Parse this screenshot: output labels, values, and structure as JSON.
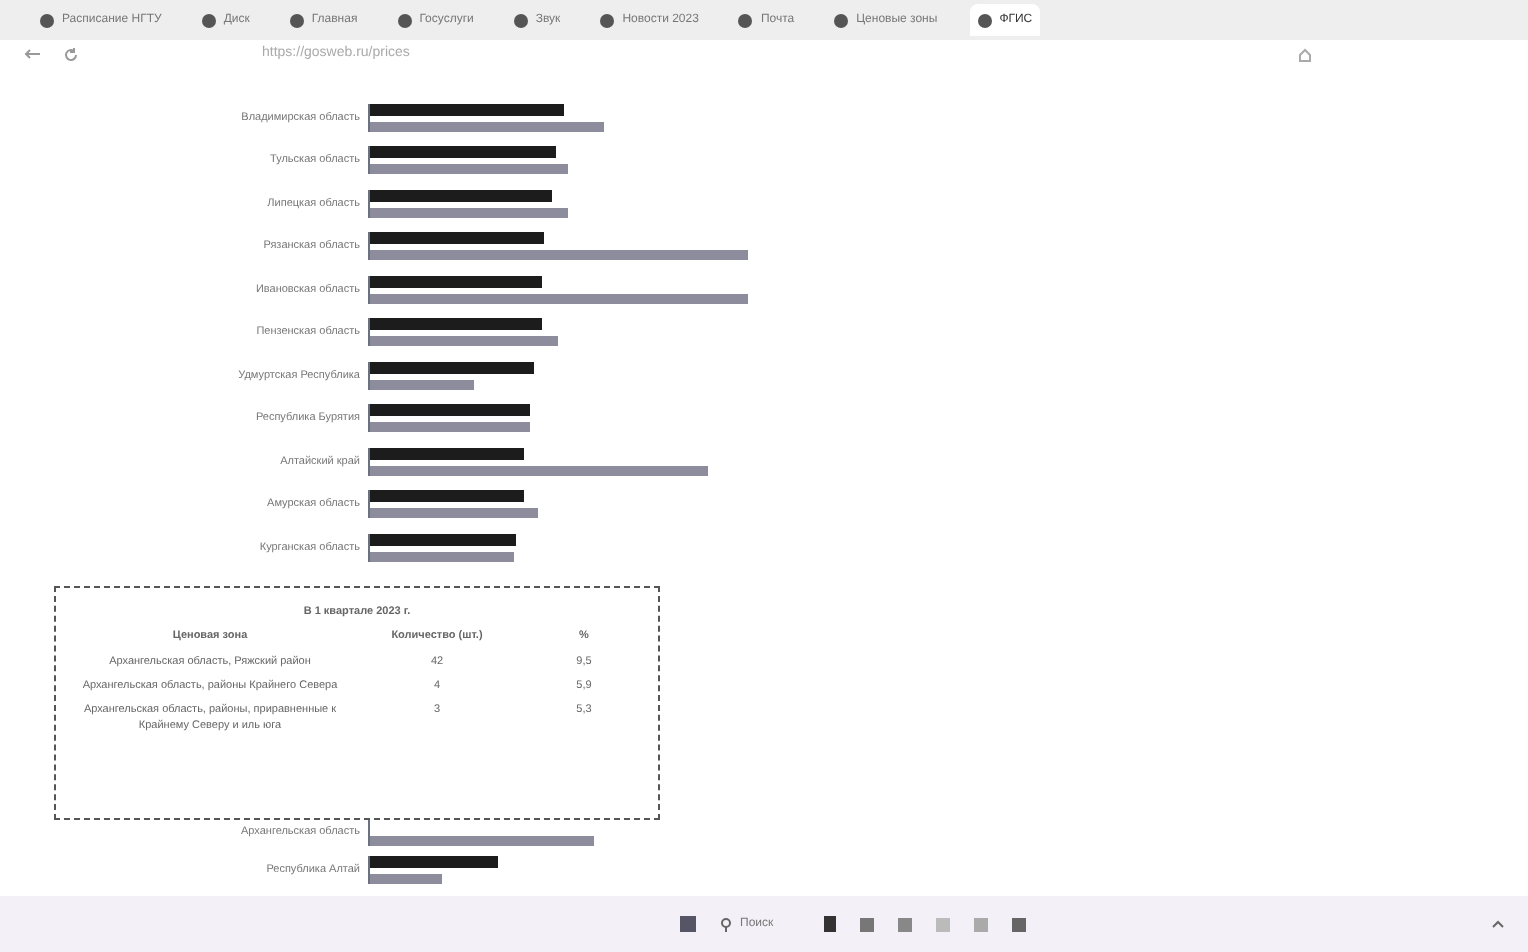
{
  "tabs": [
    {
      "title": "Расписание НГТУ",
      "selected": false
    },
    {
      "title": "Диск",
      "selected": false
    },
    {
      "title": "Главная",
      "selected": false
    },
    {
      "title": "Госуслуги",
      "selected": false
    },
    {
      "title": "Звук",
      "selected": false
    },
    {
      "title": "Новости 2023",
      "selected": false
    },
    {
      "title": "Почта",
      "selected": false
    },
    {
      "title": "Ценовые зоны",
      "selected": false
    },
    {
      "title": "ФГИС",
      "selected": true
    }
  ],
  "address_bar": {
    "url": "https://gosweb.ru/prices"
  },
  "chart": {
    "categories": [
      "Владимирская область",
      "Тульская область",
      "Липецкая область",
      "Рязанская область",
      "Ивановская область",
      "Пензенская область",
      "Удмуртская Республика",
      "Республика Бурятия",
      "Алтайский край",
      "Амурская область",
      "Курганская область"
    ],
    "categories_below": [
      "Архангельская область",
      "Республика Алтай"
    ]
  },
  "popup": {
    "title": "В 1 квартале 2023 г.",
    "columns": [
      "Ценовая зона",
      "Количество (шт.)",
      "%"
    ],
    "rows": [
      [
        "Архангельская область, Ряжский район",
        "42",
        "9,5"
      ],
      [
        "Архангельская область, районы Крайнего Севера",
        "4",
        "5,9"
      ],
      [
        "Архангельская область, районы, приравненные к Крайнему Северу и иль юга",
        "3",
        "5,3"
      ]
    ]
  },
  "taskbar": {
    "search": "Поиск"
  }
}
